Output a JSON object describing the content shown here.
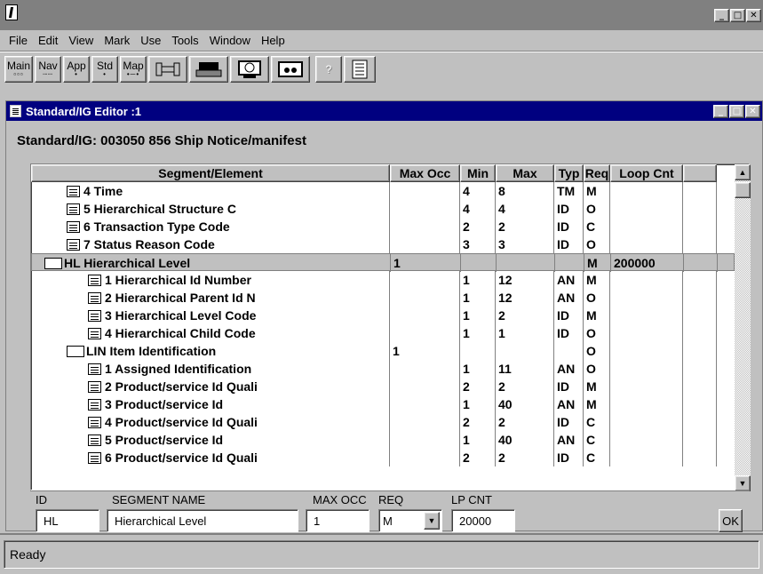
{
  "menu": [
    "File",
    "Edit",
    "View",
    "Mark",
    "Use",
    "Tools",
    "Window",
    "Help"
  ],
  "toolbar": {
    "main": "Main",
    "nav": "Nav",
    "app": "App",
    "std": "Std",
    "map": "Map",
    "help": "?"
  },
  "editor": {
    "title": "Standard/IG Editor :1",
    "standard_label": "Standard/IG: 003050 856 Ship Notice/manifest"
  },
  "columns": [
    "Segment/Element",
    "Max Occ",
    "Min",
    "Max",
    "Typ",
    "Req",
    "Loop Cnt"
  ],
  "rows": [
    {
      "name": "4  Time",
      "max_occ": "",
      "min": "4",
      "max": "8",
      "typ": "TM",
      "req": "M",
      "loop": ""
    },
    {
      "name": "5  Hierarchical Structure C",
      "max_occ": "",
      "min": "4",
      "max": "4",
      "typ": "ID",
      "req": "O",
      "loop": ""
    },
    {
      "name": "6  Transaction Type Code",
      "max_occ": "",
      "min": "2",
      "max": "2",
      "typ": "ID",
      "req": "C",
      "loop": ""
    },
    {
      "name": "7  Status Reason Code",
      "max_occ": "",
      "min": "3",
      "max": "3",
      "typ": "ID",
      "req": "O",
      "loop": ""
    },
    {
      "name": "HL  Hierarchical Level",
      "max_occ": "1",
      "min": "",
      "max": "",
      "typ": "",
      "req": "M",
      "loop": "200000"
    },
    {
      "name": "1  Hierarchical Id Number",
      "max_occ": "",
      "min": "1",
      "max": "12",
      "typ": "AN",
      "req": "M",
      "loop": ""
    },
    {
      "name": "2  Hierarchical Parent Id N",
      "max_occ": "",
      "min": "1",
      "max": "12",
      "typ": "AN",
      "req": "O",
      "loop": ""
    },
    {
      "name": "3  Hierarchical Level Code",
      "max_occ": "",
      "min": "1",
      "max": "2",
      "typ": "ID",
      "req": "M",
      "loop": ""
    },
    {
      "name": "4  Hierarchical Child Code",
      "max_occ": "",
      "min": "1",
      "max": "1",
      "typ": "ID",
      "req": "O",
      "loop": ""
    },
    {
      "name": "LIN  Item Identification",
      "max_occ": "1",
      "min": "",
      "max": "",
      "typ": "",
      "req": "O",
      "loop": ""
    },
    {
      "name": "1  Assigned Identification",
      "max_occ": "",
      "min": "1",
      "max": "11",
      "typ": "AN",
      "req": "O",
      "loop": ""
    },
    {
      "name": "2  Product/service Id Quali",
      "max_occ": "",
      "min": "2",
      "max": "2",
      "typ": "ID",
      "req": "M",
      "loop": ""
    },
    {
      "name": "3  Product/service Id",
      "max_occ": "",
      "min": "1",
      "max": "40",
      "typ": "AN",
      "req": "M",
      "loop": ""
    },
    {
      "name": "4  Product/service Id Quali",
      "max_occ": "",
      "min": "2",
      "max": "2",
      "typ": "ID",
      "req": "C",
      "loop": ""
    },
    {
      "name": "5  Product/service Id",
      "max_occ": "",
      "min": "1",
      "max": "40",
      "typ": "AN",
      "req": "C",
      "loop": ""
    },
    {
      "name": "6  Product/service Id Quali",
      "max_occ": "",
      "min": "2",
      "max": "2",
      "typ": "ID",
      "req": "C",
      "loop": ""
    }
  ],
  "detail": {
    "id_label": "ID",
    "id_value": "HL",
    "name_label": "SEGMENT NAME",
    "name_value": "Hierarchical Level",
    "occ_label": "MAX OCC",
    "occ_value": "1",
    "req_label": "REQ",
    "req_value": "M",
    "lp_label": "LP CNT",
    "lp_value": "20000",
    "ok": "OK"
  },
  "status": "Ready"
}
